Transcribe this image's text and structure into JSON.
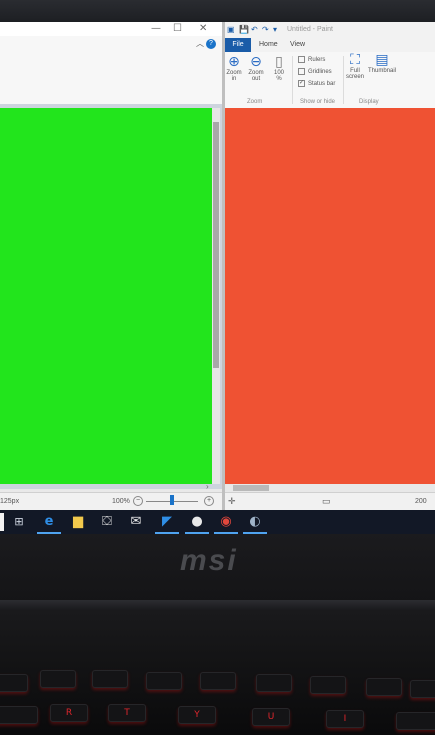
{
  "left_window": {
    "title_controls": [
      "—",
      "☐",
      "✕"
    ],
    "status_size": "125px",
    "status_zoom": "100%",
    "canvas_color": "#22e51c"
  },
  "paint": {
    "title": "Untitled - Paint",
    "tabs": {
      "file": "File",
      "home": "Home",
      "view": "View"
    },
    "zoom_in": [
      "Zoom",
      "in"
    ],
    "zoom_out": [
      "Zoom",
      "out"
    ],
    "hundred": [
      "100",
      "%"
    ],
    "rulers": "Rulers",
    "gridlines": "Gridlines",
    "status_bar": "Status bar",
    "full_screen": [
      "Full",
      "screen"
    ],
    "thumbnail": "Thumbnail",
    "groups": {
      "zoom": "Zoom",
      "show_hide": "Show or hide",
      "display": "Display"
    },
    "status_dim": "200",
    "canvas_color": "#ef5233"
  },
  "brand": "msi",
  "keys": [
    "R",
    "T",
    "Y",
    "U",
    "I"
  ]
}
